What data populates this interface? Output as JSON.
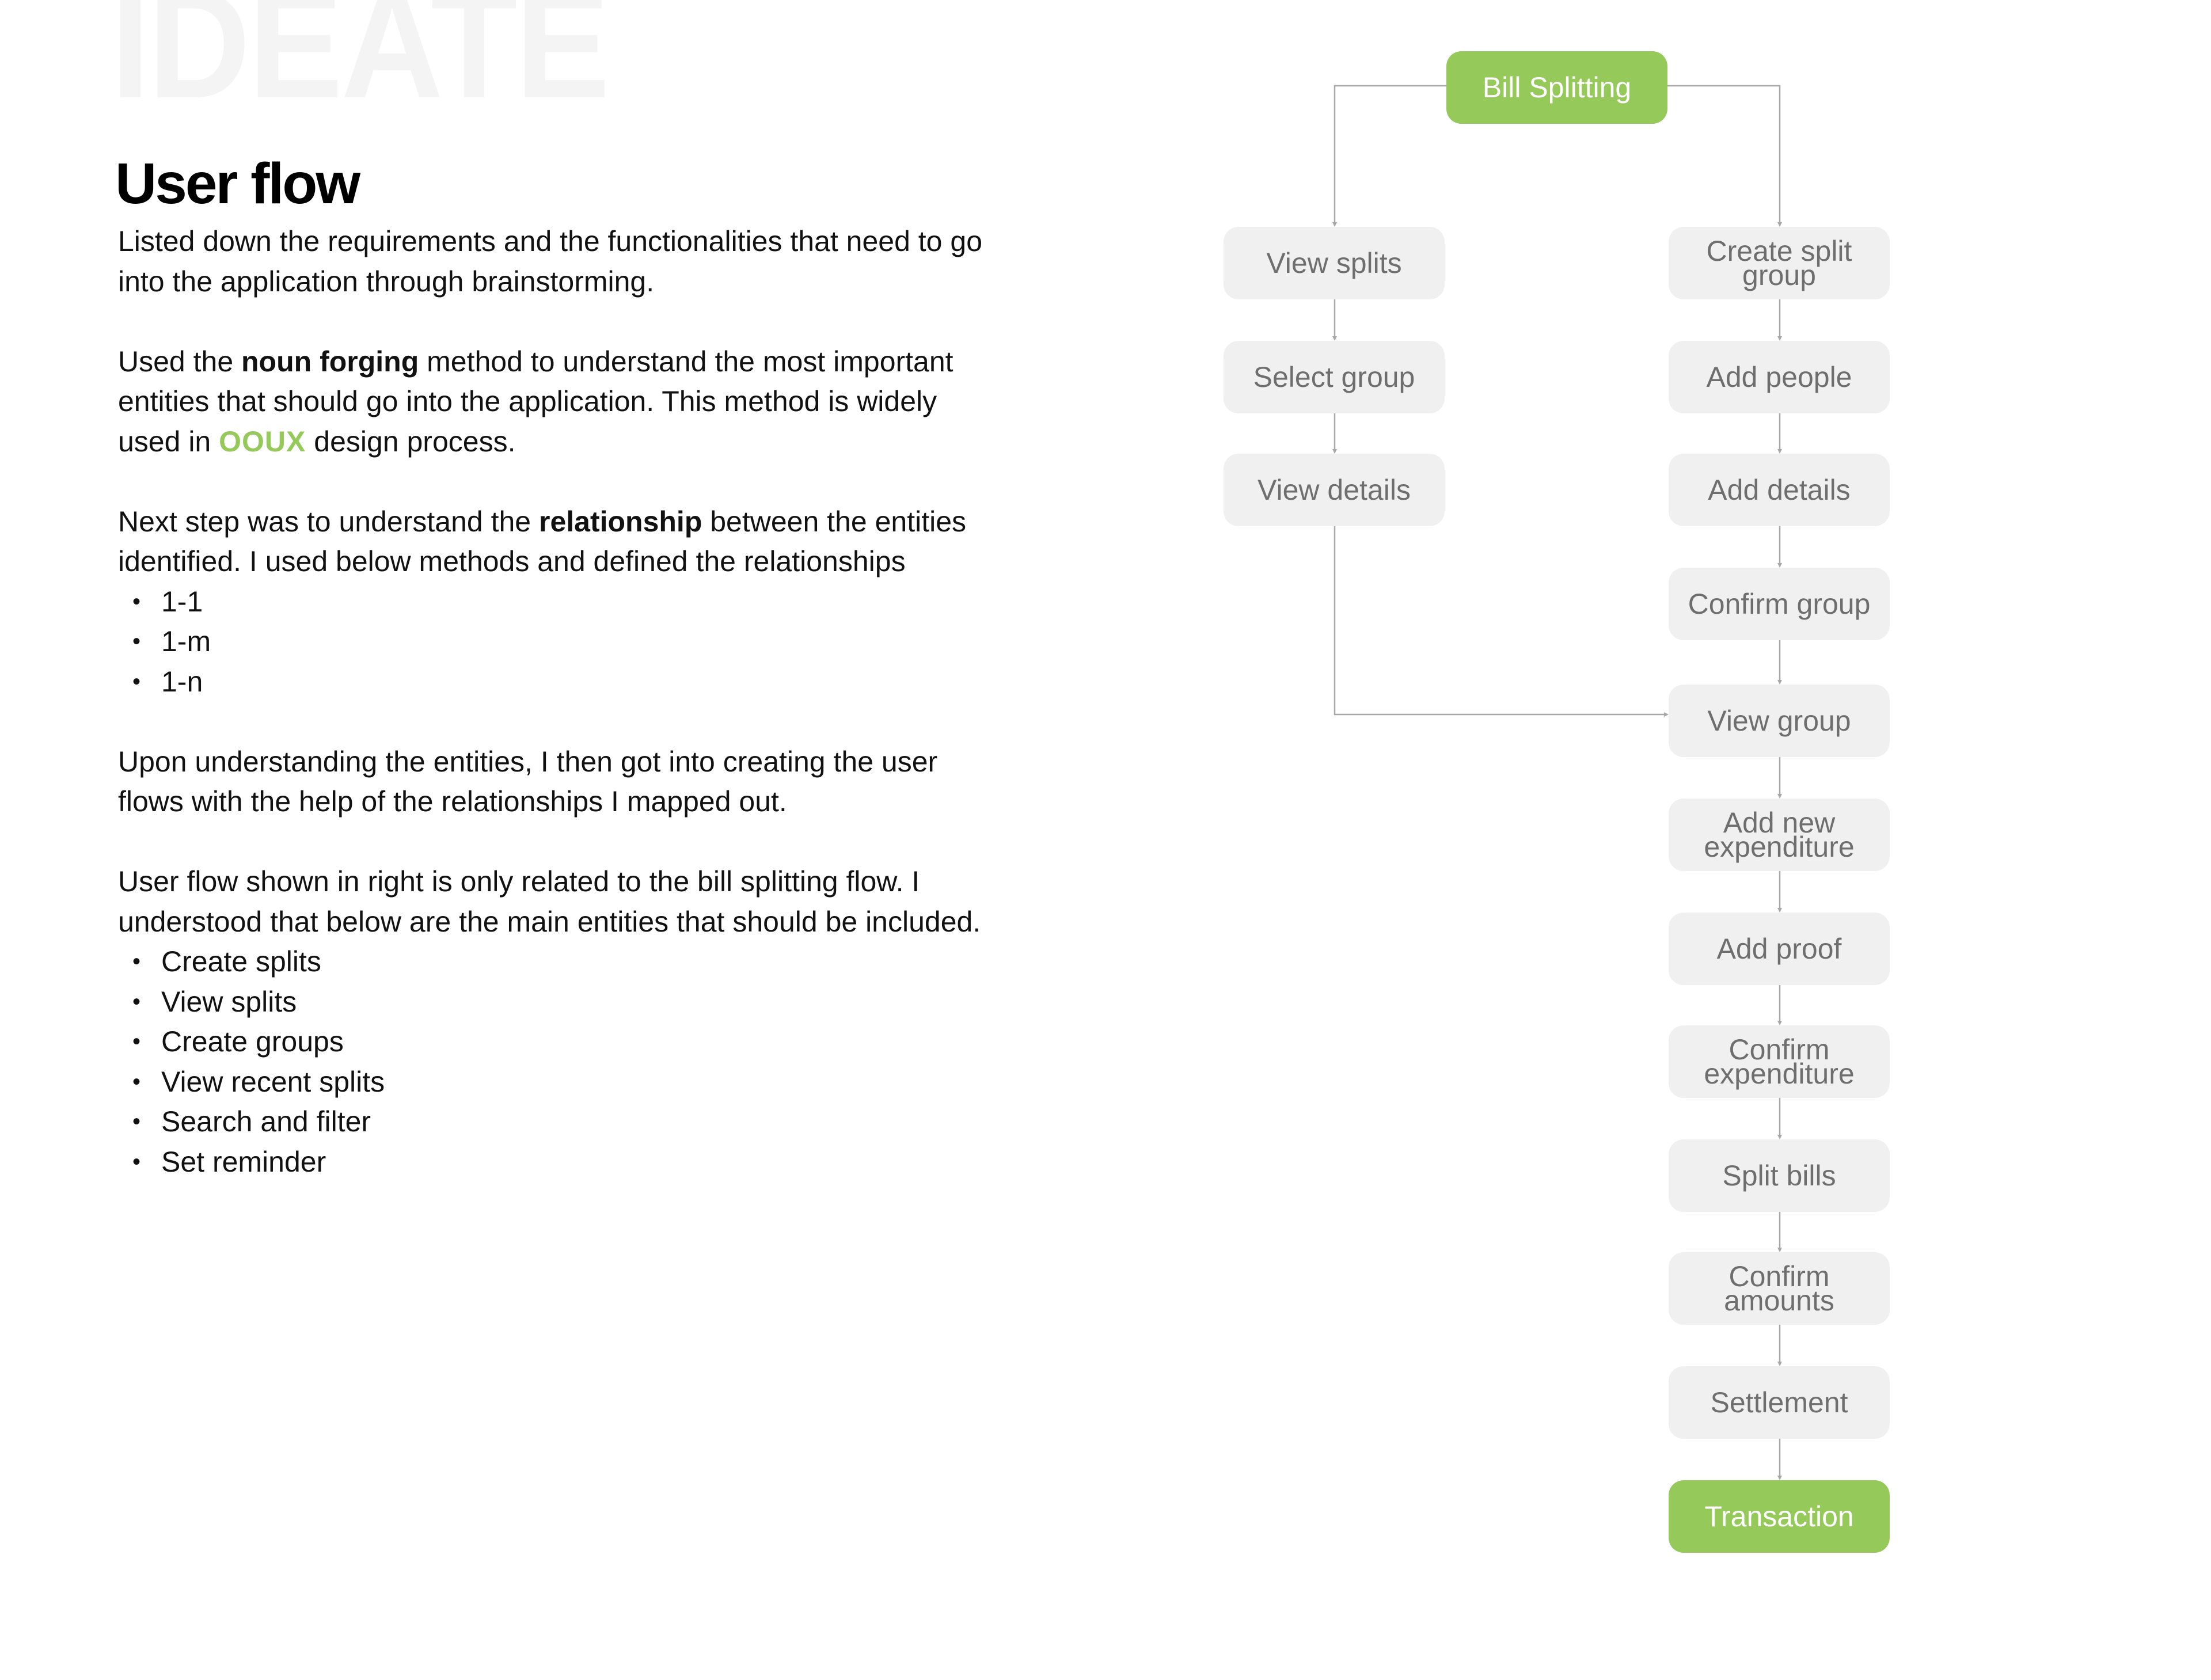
{
  "background_title": "IDEATE",
  "section_title": "User flow",
  "paragraphs": {
    "p1": "Listed down the requirements and the functionalities that need to go into the application through brainstorming.",
    "p2_pre": "Used the ",
    "p2_bold": "noun forging",
    "p2_mid": " method to understand the most important entities that should go into the application. This method is widely used in ",
    "p2_brand": "OOUX",
    "p2_post": " design process.",
    "p3_pre": "Next step was to understand the ",
    "p3_bold": "relationship",
    "p3_post": " between the entities identified. I used below methods and defined the relationships",
    "relationships": [
      "1-1",
      "1-m",
      "1-n"
    ],
    "p4": "Upon understanding the entities, I then got into creating the user flows with the help of the relationships I mapped out.",
    "p5": "User flow shown in right is only related to the bill splitting flow. I understood that below are the main entities that should be included.",
    "entities": [
      "Create splits",
      "View splits",
      "Create groups",
      "View recent splits",
      "Search and filter",
      "Set reminder"
    ]
  },
  "colors": {
    "accent_green": "#95c95a",
    "node_gray": "#f0f0f0",
    "node_text": "#6e6e6e",
    "connector": "#a8a8a8",
    "background_title": "#f4f4f4"
  },
  "flow": {
    "root": "Bill Splitting",
    "left_branch": [
      "View splits",
      "Select group",
      "View details"
    ],
    "right_branch": [
      "Create split group",
      "Add people",
      "Add details",
      "Confirm group",
      "View group",
      "Add new expenditure",
      "Add proof",
      "Confirm expenditure",
      "Split bills",
      "Confirm amounts",
      "Settlement",
      "Transaction"
    ],
    "merge_target": "View group",
    "terminal": "Transaction"
  }
}
